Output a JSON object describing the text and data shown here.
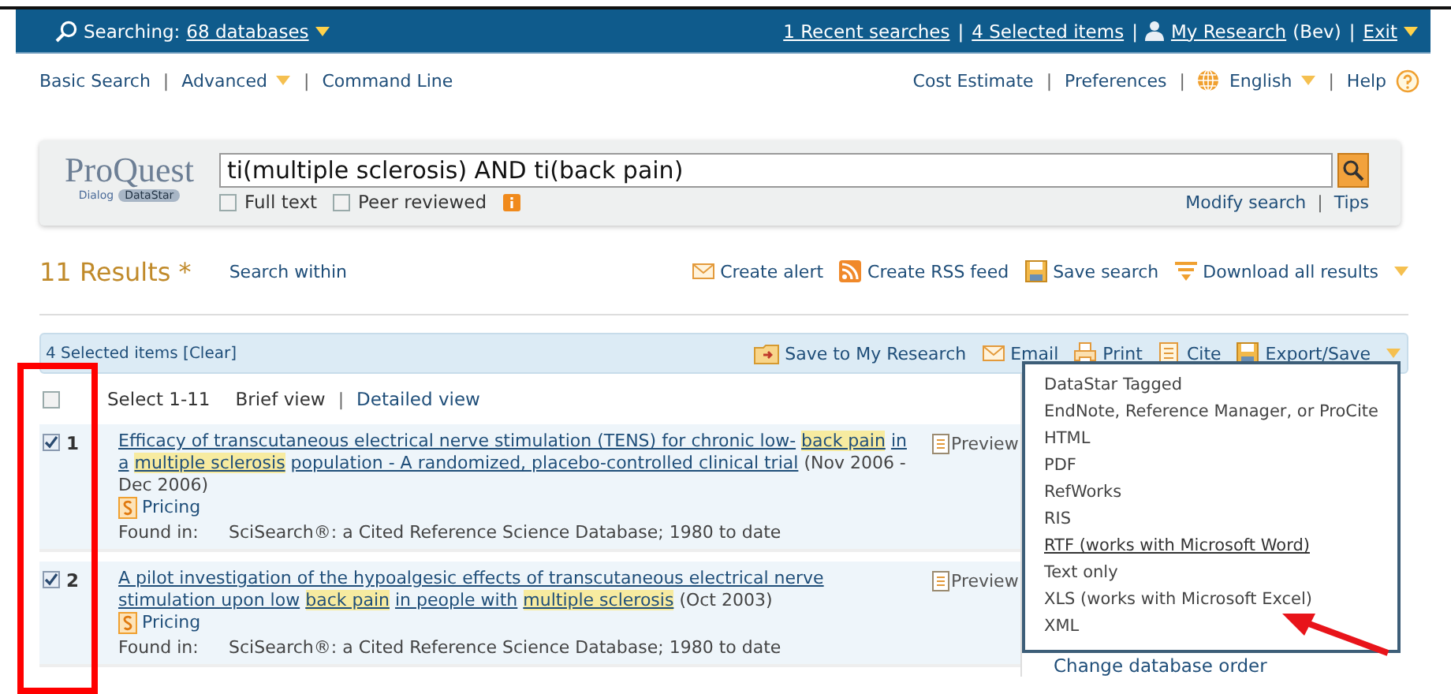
{
  "top_bar": {
    "searching_label": "Searching:",
    "databases_link": "68 databases",
    "recent_searches": "1 Recent searches",
    "selected_items": "4 Selected items",
    "my_research": "My Research",
    "user": "(Bev)",
    "exit": "Exit",
    "separator": "|"
  },
  "nav": {
    "left": [
      "Basic Search",
      "Advanced",
      "Command Line"
    ],
    "right": [
      "Cost Estimate",
      "Preferences",
      "English",
      "Help"
    ],
    "separator": "|"
  },
  "search": {
    "logo_name": "ProQuest",
    "logo_sub_1": "Dialog",
    "logo_sub_2": "DataStar",
    "value": "ti(multiple sclerosis) AND ti(back pain)",
    "options": [
      {
        "label": "Full text",
        "checked": false
      },
      {
        "label": "Peer reviewed",
        "checked": false
      }
    ],
    "links": [
      "Modify search",
      "Tips"
    ],
    "separator": "|"
  },
  "results_header": {
    "count": "11 Results *",
    "search_within": "Search within",
    "actions": [
      {
        "kind": "alert",
        "label": "Create alert"
      },
      {
        "kind": "rss",
        "label": "Create RSS feed"
      },
      {
        "kind": "save",
        "label": "Save search"
      },
      {
        "kind": "download",
        "label": "Download all results",
        "menu": true
      }
    ]
  },
  "selection_bar": {
    "label": "4 Selected items [Clear]",
    "actions": [
      {
        "kind": "folder",
        "label": "Save to My Research"
      },
      {
        "kind": "email",
        "label": "Email"
      },
      {
        "kind": "print",
        "label": "Print"
      },
      {
        "kind": "cite",
        "label": "Cite"
      },
      {
        "kind": "export",
        "label": "Export/Save",
        "menu": true
      }
    ]
  },
  "list_controls": {
    "select_all": {
      "label": "Select 1-11",
      "checked": false
    },
    "views": [
      "Brief view",
      "Detailed view"
    ],
    "separator": "|"
  },
  "results": [
    {
      "number": "1",
      "checked": true,
      "title": [
        {
          "text": "Efficacy of transcutaneous electrical nerve stimulation (TENS) for chronic low-",
          "highlight": false
        },
        {
          "text": "back pain",
          "highlight": true
        },
        {
          "text": "in a",
          "highlight": false
        },
        {
          "text": "multiple sclerosis",
          "highlight": true
        },
        {
          "text": "population - A randomized, placebo-controlled clinical trial",
          "highlight": false
        }
      ],
      "date": "(Nov 2006 - Dec 2006)",
      "pricing": "Pricing",
      "preview": "Preview",
      "found_label": "Found in:",
      "found_value": "SciSearch®: a Cited Reference Science Database; 1980 to date"
    },
    {
      "number": "2",
      "checked": true,
      "title": [
        {
          "text": "A pilot investigation of the hypoalgesic effects of transcutaneous electrical nerve stimulation upon low",
          "highlight": false
        },
        {
          "text": "back pain",
          "highlight": true
        },
        {
          "text": "in people with",
          "highlight": false
        },
        {
          "text": "multiple sclerosis",
          "highlight": true
        }
      ],
      "date": "(Oct 2003)",
      "pricing": "Pricing",
      "preview": "Preview",
      "found_label": "Found in:",
      "found_value": "SciSearch®: a Cited Reference Science Database; 1980 to date"
    }
  ],
  "export_menu": {
    "items": [
      {
        "label": "DataStar Tagged",
        "hovered": false
      },
      {
        "label": "EndNote, Reference Manager, or ProCite",
        "hovered": false
      },
      {
        "label": "HTML",
        "hovered": false
      },
      {
        "label": "PDF",
        "hovered": false
      },
      {
        "label": "RefWorks",
        "hovered": false
      },
      {
        "label": "RIS",
        "hovered": false
      },
      {
        "label": "RTF (works with Microsoft Word)",
        "hovered": true
      },
      {
        "label": "Text only",
        "hovered": false
      },
      {
        "label": "XLS (works with Microsoft Excel)",
        "hovered": false
      },
      {
        "label": "XML",
        "hovered": false
      }
    ]
  },
  "side_panel": {
    "link": "Change database order"
  },
  "annotations": [
    {
      "kind": "box",
      "color": "#ff0000"
    },
    {
      "kind": "arrow",
      "color": "#e8141a"
    }
  ]
}
